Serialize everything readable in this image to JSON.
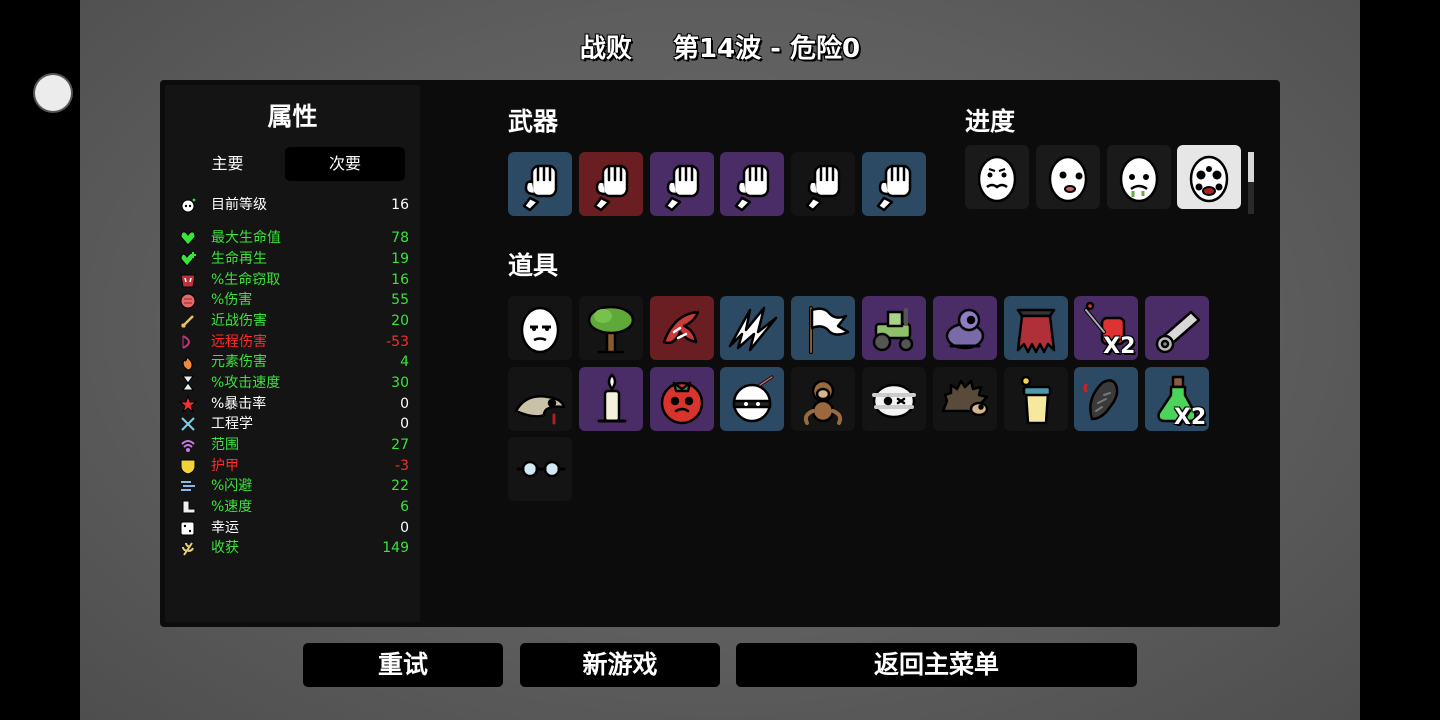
{
  "header": {
    "result": "战败",
    "wave_info": "第14波 - 危险0"
  },
  "stats": {
    "title": "属性",
    "tabs": {
      "primary": "主要",
      "secondary": "次要"
    },
    "rows": [
      {
        "label": "目前等级",
        "value": "16",
        "color": "#ffffff",
        "icon": "level-icon"
      },
      {
        "label": "最大生命值",
        "value": "78",
        "color": "#39e339",
        "icon": "heart-icon"
      },
      {
        "label": "生命再生",
        "value": "19",
        "color": "#39e339",
        "icon": "regen-heart-icon"
      },
      {
        "label": "%生命窃取",
        "value": "16",
        "color": "#39e339",
        "icon": "lifesteal-icon"
      },
      {
        "label": "%伤害",
        "value": "55",
        "color": "#39e339",
        "icon": "damage-icon"
      },
      {
        "label": "近战伤害",
        "value": "20",
        "color": "#39e339",
        "icon": "sword-icon"
      },
      {
        "label": "远程伤害",
        "value": "-53",
        "color": "#ff2a2a",
        "icon": "bow-icon"
      },
      {
        "label": "元素伤害",
        "value": "4",
        "color": "#39e339",
        "icon": "flame-icon"
      },
      {
        "label": "%攻击速度",
        "value": "30",
        "color": "#39e339",
        "icon": "hourglass-icon"
      },
      {
        "label": "%暴击率",
        "value": "0",
        "color": "#ffffff",
        "icon": "crit-icon"
      },
      {
        "label": "工程学",
        "value": "0",
        "color": "#ffffff",
        "icon": "wrench-icon"
      },
      {
        "label": "范围",
        "value": "27",
        "color": "#39e339",
        "icon": "range-icon"
      },
      {
        "label": "护甲",
        "value": "-3",
        "color": "#ff2a2a",
        "icon": "shield-icon"
      },
      {
        "label": "%闪避",
        "value": "22",
        "color": "#39e339",
        "icon": "dodge-icon"
      },
      {
        "label": "%速度",
        "value": "6",
        "color": "#39e339",
        "icon": "boot-icon"
      },
      {
        "label": "幸运",
        "value": "0",
        "color": "#ffffff",
        "icon": "dice-icon"
      },
      {
        "label": "收获",
        "value": "149",
        "color": "#39e339",
        "icon": "wheat-icon"
      }
    ]
  },
  "weapons": {
    "title": "武器",
    "items": [
      {
        "icon": "fist-icon",
        "tier_color": "#2c4a63"
      },
      {
        "icon": "fist-icon",
        "tier_color": "#6a1e22"
      },
      {
        "icon": "fist-icon",
        "tier_color": "#4a2c66"
      },
      {
        "icon": "fist-icon",
        "tier_color": "#4a2c66"
      },
      {
        "icon": "fist-icon",
        "tier_color": "#141414"
      },
      {
        "icon": "fist-icon",
        "tier_color": "#2c4a63"
      }
    ]
  },
  "progress": {
    "title": "进度",
    "items": [
      {
        "icon": "egg-face-mustache-icon",
        "bg": "#1a1a1a"
      },
      {
        "icon": "egg-face-bald-icon",
        "bg": "#1a1a1a"
      },
      {
        "icon": "egg-face-sick-icon",
        "bg": "#1a1a1a"
      },
      {
        "icon": "egg-face-many-eyes-icon",
        "bg": "#e6e6e6"
      }
    ]
  },
  "items": {
    "title": "道具",
    "list": [
      {
        "icon": "egg-face-icon",
        "bg": "#141414",
        "qty": ""
      },
      {
        "icon": "tree-icon",
        "bg": "#141414",
        "qty": ""
      },
      {
        "icon": "lobster-icon",
        "bg": "#6a1e22",
        "qty": ""
      },
      {
        "icon": "claw-scratch-icon",
        "bg": "#2c4a63",
        "qty": ""
      },
      {
        "icon": "white-flag-icon",
        "bg": "#2c4a63",
        "qty": ""
      },
      {
        "icon": "tractor-icon",
        "bg": "#4a2c66",
        "qty": ""
      },
      {
        "icon": "toy-robot-icon",
        "bg": "#4a2c66",
        "qty": ""
      },
      {
        "icon": "torn-cape-icon",
        "bg": "#2c4a63",
        "qty": ""
      },
      {
        "icon": "blood-bag-icon",
        "bg": "#4a2c66",
        "qty": "X2"
      },
      {
        "icon": "cannon-icon",
        "bg": "#4a2c66",
        "qty": ""
      },
      {
        "icon": "snail-icon",
        "bg": "#141414",
        "qty": ""
      },
      {
        "icon": "candle-icon",
        "bg": "#4a2c66",
        "qty": ""
      },
      {
        "icon": "tomato-icon",
        "bg": "#4a2c66",
        "qty": ""
      },
      {
        "icon": "ninja-head-icon",
        "bg": "#2c4a63",
        "qty": ""
      },
      {
        "icon": "monkey-icon",
        "bg": "#141414",
        "qty": ""
      },
      {
        "icon": "bandaged-face-icon",
        "bg": "#141414",
        "qty": ""
      },
      {
        "icon": "hedgehog-icon",
        "bg": "#141414",
        "qty": ""
      },
      {
        "icon": "juice-cup-icon",
        "bg": "#141414",
        "qty": ""
      },
      {
        "icon": "leech-icon",
        "bg": "#2c4a63",
        "qty": ""
      },
      {
        "icon": "green-potion-icon",
        "bg": "#2c4a63",
        "qty": "X2"
      },
      {
        "icon": "glasses-icon",
        "bg": "#141414",
        "qty": ""
      }
    ]
  },
  "buttons": {
    "retry": "重试",
    "new_game": "新游戏",
    "main_menu": "返回主菜单"
  }
}
